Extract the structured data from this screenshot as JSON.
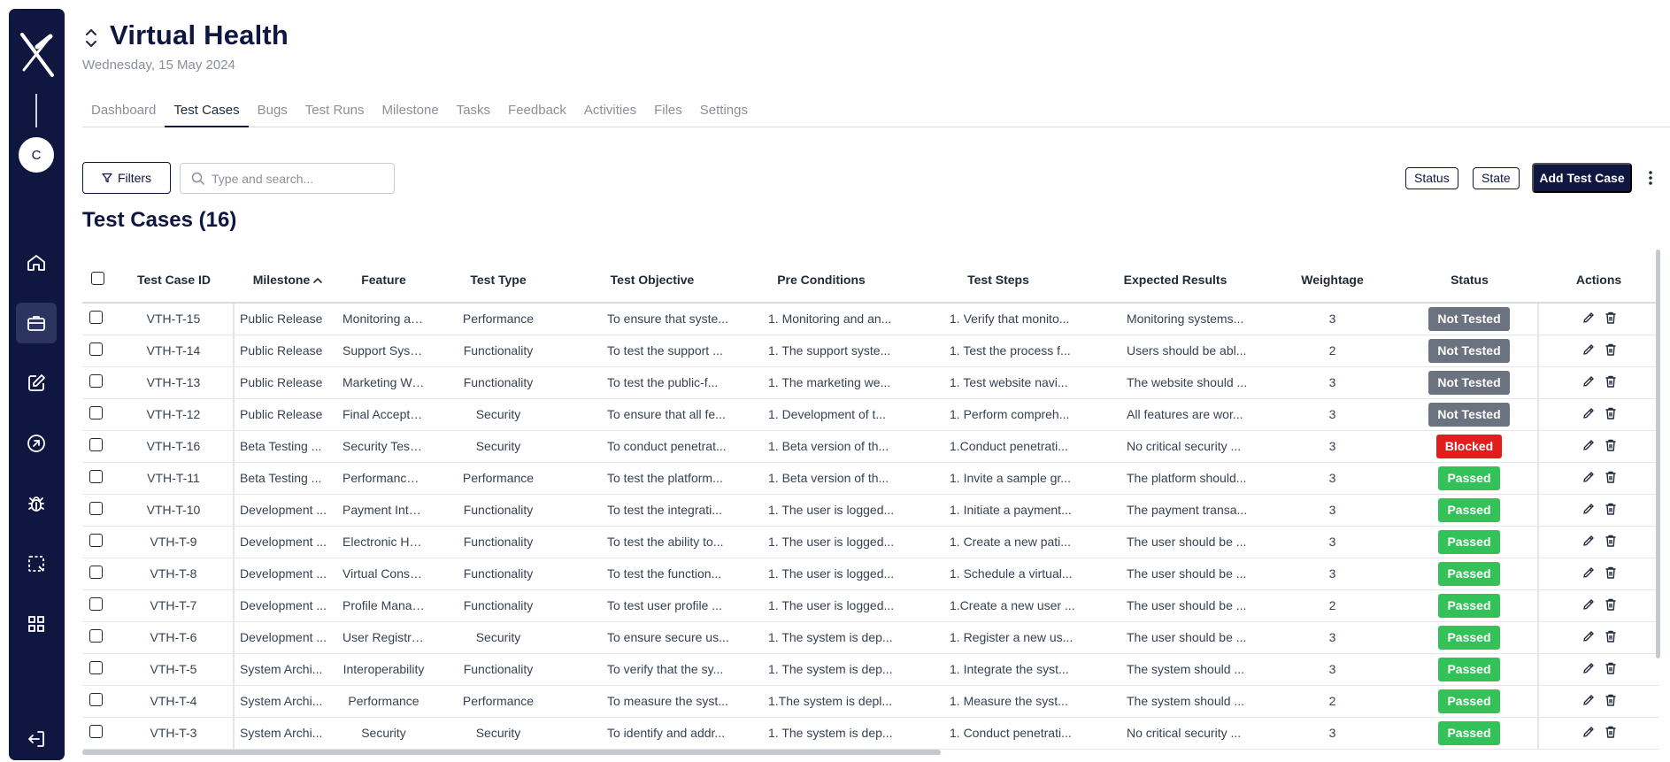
{
  "app": {
    "avatar_initial": "C"
  },
  "header": {
    "title": "Virtual Health",
    "date": "Wednesday, 15 May 2024"
  },
  "tabs": [
    {
      "label": "Dashboard"
    },
    {
      "label": "Test Cases",
      "active": true
    },
    {
      "label": "Bugs"
    },
    {
      "label": "Test Runs"
    },
    {
      "label": "Milestone"
    },
    {
      "label": "Tasks"
    },
    {
      "label": "Feedback"
    },
    {
      "label": "Activities"
    },
    {
      "label": "Files"
    },
    {
      "label": "Settings"
    }
  ],
  "toolbar": {
    "filters_label": "Filters",
    "search_placeholder": "Type and search...",
    "search_value": "",
    "status_chip": "Status",
    "state_chip": "State",
    "add_label": "Add Test Case"
  },
  "section_title": "Test Cases (16)",
  "table": {
    "headers": {
      "id": "Test Case ID",
      "milestone": "Milestone",
      "feature": "Feature",
      "type": "Test Type",
      "objective": "Test Objective",
      "pre": "Pre Conditions",
      "steps": "Test Steps",
      "expected": "Expected Results",
      "weightage": "Weightage",
      "status": "Status",
      "actions": "Actions"
    },
    "rows": [
      {
        "id": "VTH-T-15",
        "milestone": "Public Release",
        "feature": "Monitoring and ...",
        "type": "Performance",
        "objective": "To ensure that syste...",
        "pre": "1. Monitoring and an...",
        "steps": "1. Verify that monito...",
        "expected": "Monitoring systems...",
        "weightage": "3",
        "status": "Not Tested"
      },
      {
        "id": "VTH-T-14",
        "milestone": "Public Release",
        "feature": "Support System",
        "type": "Functionality",
        "objective": "To test the support ...",
        "pre": "1. The support syste...",
        "steps": "1. Test the process f...",
        "expected": "Users should be abl...",
        "weightage": "2",
        "status": "Not Tested"
      },
      {
        "id": "VTH-T-13",
        "milestone": "Public Release",
        "feature": "Marketing Websi...",
        "type": "Functionality",
        "objective": "To test the public-f...",
        "pre": "1. The marketing we...",
        "steps": "1. Test website navi...",
        "expected": "The website should ...",
        "weightage": "3",
        "status": "Not Tested"
      },
      {
        "id": "VTH-T-12",
        "milestone": "Public Release",
        "feature": "Final Acceptanc...",
        "type": "Security",
        "objective": "To ensure that all fe...",
        "pre": "1. Development of t...",
        "steps": "1. Perform compreh...",
        "expected": "All features are wor...",
        "weightage": "3",
        "status": "Not Tested"
      },
      {
        "id": "VTH-T-16",
        "milestone": "Beta Testing ...",
        "feature": "Security Testing",
        "type": "Security",
        "objective": "To conduct penetrat...",
        "pre": "1. Beta version of th...",
        "steps": "1.Conduct penetrati...",
        "expected": "No critical security ...",
        "weightage": "3",
        "status": "Blocked"
      },
      {
        "id": "VTH-T-11",
        "milestone": "Beta Testing ...",
        "feature": "Performance un...",
        "type": "Performance",
        "objective": "To test the platform...",
        "pre": "1. Beta version of th...",
        "steps": "1. Invite a sample gr...",
        "expected": "The platform should...",
        "weightage": "3",
        "status": "Passed"
      },
      {
        "id": "VTH-T-10",
        "milestone": "Development ...",
        "feature": "Payment Integra...",
        "type": "Functionality",
        "objective": "To test the integrati...",
        "pre": "1. The user is logged...",
        "steps": "1. Initiate a payment...",
        "expected": "The payment transa...",
        "weightage": "3",
        "status": "Passed"
      },
      {
        "id": "VTH-T-9",
        "milestone": "Development ...",
        "feature": "Electronic Healt...",
        "type": "Functionality",
        "objective": "To test the ability to...",
        "pre": "1. The user is logged...",
        "steps": "1. Create a new pati...",
        "expected": "The user should be ...",
        "weightage": "3",
        "status": "Passed"
      },
      {
        "id": "VTH-T-8",
        "milestone": "Development ...",
        "feature": "Virtual Consultat...",
        "type": "Functionality",
        "objective": "To test the function...",
        "pre": "1. The user is logged...",
        "steps": "1. Schedule a virtual...",
        "expected": "The user should be ...",
        "weightage": "3",
        "status": "Passed"
      },
      {
        "id": "VTH-T-7",
        "milestone": "Development ...",
        "feature": "Profile Managem...",
        "type": "Functionality",
        "objective": "To test user profile ...",
        "pre": "1. The user is logged...",
        "steps": "1.Create a new user ...",
        "expected": "The user should be ...",
        "weightage": "2",
        "status": "Passed"
      },
      {
        "id": "VTH-T-6",
        "milestone": "Development ...",
        "feature": "User Registratio...",
        "type": "Security",
        "objective": "To ensure secure us...",
        "pre": "1. The system is dep...",
        "steps": "1. Register a new us...",
        "expected": "The user should be ...",
        "weightage": "3",
        "status": "Passed"
      },
      {
        "id": "VTH-T-5",
        "milestone": "System Archi...",
        "feature": "Interoperability",
        "type": "Functionality",
        "objective": "To verify that the sy...",
        "pre": "1. The system is dep...",
        "steps": "1. Integrate the syst...",
        "expected": "The system should ...",
        "weightage": "3",
        "status": "Passed"
      },
      {
        "id": "VTH-T-4",
        "milestone": "System Archi...",
        "feature": "Performance",
        "type": "Performance",
        "objective": "To measure the syst...",
        "pre": "1.The system is depl...",
        "steps": "1. Measure the syst...",
        "expected": "The system should ...",
        "weightage": "2",
        "status": "Passed"
      },
      {
        "id": "VTH-T-3",
        "milestone": "System Archi...",
        "feature": "Security",
        "type": "Security",
        "objective": "To identify and addr...",
        "pre": "1. The system is dep...",
        "steps": "1. Conduct penetrati...",
        "expected": "No critical security ...",
        "weightage": "3",
        "status": "Passed"
      }
    ]
  },
  "status_colors": {
    "Not Tested": "#6b7280",
    "Blocked": "#e11d1d",
    "Passed": "#33c15a"
  },
  "brand_colors": {
    "navy": "#0f1640",
    "active_nav": "#2c3460"
  },
  "icons": {
    "sidebar": [
      "home-icon",
      "briefcase-icon",
      "edit-icon",
      "arrow-circle-icon",
      "bug-icon",
      "select-area-icon",
      "apps-icon",
      "logout-icon"
    ],
    "row_actions": [
      "pencil-icon",
      "trash-icon"
    ]
  }
}
